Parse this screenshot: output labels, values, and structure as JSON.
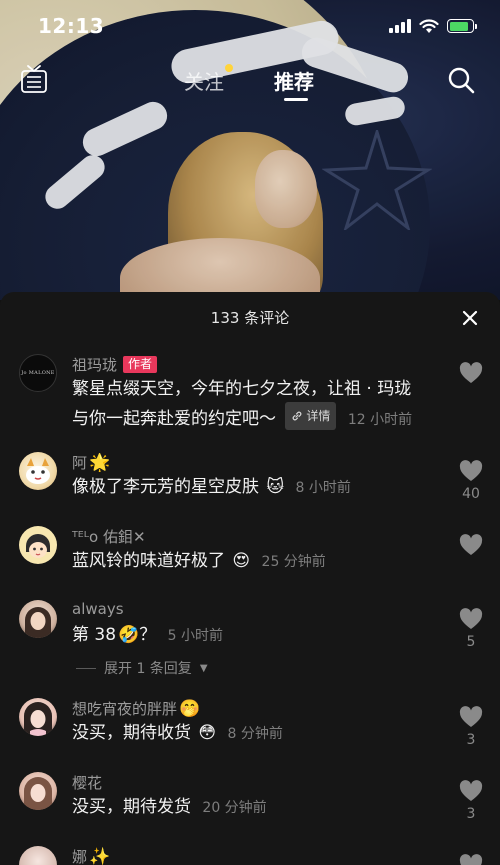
{
  "status_bar": {
    "time": "12:13",
    "battery_level": 0.85
  },
  "nav": {
    "live_icon": "live-tv-icon",
    "tabs": [
      {
        "label": "关注",
        "has_dot": true,
        "active": false
      },
      {
        "label": "推荐",
        "active": true
      }
    ],
    "search_icon": "search-icon"
  },
  "comments_panel": {
    "title": "133 条评论",
    "close_icon": "close-icon",
    "comments": [
      {
        "name": "祖玛珑",
        "tag": "作者",
        "text_line1": "繁星点缀天空，今年的七夕之夜，让祖 · 玛珑",
        "text_line2": "与你一起奔赴爱的约定吧～",
        "detail_label": "详情",
        "time": "12 小时前",
        "likes": "",
        "avatar_text": "Jo MALONE"
      },
      {
        "name": "阿",
        "name_emoji": "🌟",
        "text": "像极了李元芳的星空皮肤",
        "emoji": "🐱",
        "time": "8 小时前",
        "likes": "40"
      },
      {
        "name": "ᵀᴱᴸo 佑鉬✕",
        "text": "蓝风铃的味道好极了",
        "emoji": "😍",
        "time": "25 分钟前",
        "likes": ""
      },
      {
        "name": "always",
        "text": "第 38",
        "emoji": "🤣",
        "text_suffix": "？",
        "time": "5 小时前",
        "likes": "5"
      },
      {
        "name": "想吃宵夜的胖胖",
        "name_emoji": "🤭",
        "text": "没买，期待收货",
        "emoji": "😳",
        "time": "8 分钟前",
        "likes": "3"
      },
      {
        "name": "樱花",
        "text": "没买，期待发货",
        "time": "20 分钟前",
        "likes": "3"
      },
      {
        "name": "娜",
        "name_emoji": "✨",
        "text": "",
        "time": "",
        "likes": ""
      }
    ],
    "expand_replies": "展开 1 条回复"
  },
  "colors": {
    "author_tag": "#e8385c",
    "battery": "#4cd964",
    "follow_dot": "#ffd43b"
  }
}
